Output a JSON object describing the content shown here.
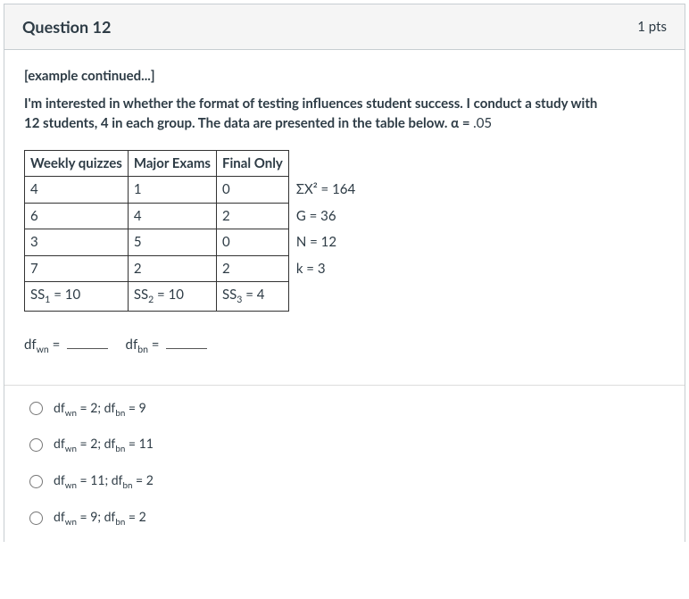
{
  "header": {
    "title": "Question 12",
    "points": "1 pts"
  },
  "intro": "[example continued...]",
  "prompt": {
    "line1": "I'm interested in whether the format of testing influences student success.  I conduct a study with",
    "line2_pre": "12 students, 4 in each group.  The data are presented in the table below.  ",
    "alpha_label": "α = ",
    "alpha_val": ".05"
  },
  "table": {
    "cols": [
      "Weekly quizzes",
      "Major Exams",
      "Final Only"
    ],
    "rows": [
      {
        "c": [
          "4",
          "1",
          "0"
        ],
        "side": "ΣX² = 164"
      },
      {
        "c": [
          "6",
          "4",
          "2"
        ],
        "side": "G = 36"
      },
      {
        "c": [
          "3",
          "5",
          "0"
        ],
        "side": "N = 12"
      },
      {
        "c": [
          "7",
          "2",
          "2"
        ],
        "side": "k = 3"
      }
    ],
    "ss": {
      "a_label": "SS",
      "a_sub": "1",
      "a_val": " = 10",
      "b_label": "SS",
      "b_sub": "2",
      "b_val": " = 10",
      "c_label": "SS",
      "c_sub": "3",
      "c_val": " = 4"
    }
  },
  "fill": {
    "a_base": "df",
    "a_sub": "wn",
    "a_eq": " = ",
    "b_base": "df",
    "b_sub": "bn",
    "b_eq": " = "
  },
  "options": [
    {
      "base1": "df",
      "sub1": "wn",
      "mid": " = 2; ",
      "base2": "df",
      "sub2": "bn",
      "tail": " = 9"
    },
    {
      "base1": "df",
      "sub1": "wn",
      "mid": " = 2; ",
      "base2": "df",
      "sub2": "bn",
      "tail": " = 11"
    },
    {
      "base1": "df",
      "sub1": "wn",
      "mid": " = 11; ",
      "base2": "df",
      "sub2": "bn",
      "tail": " = 2"
    },
    {
      "base1": "df",
      "sub1": "wn",
      "mid": " = 9; ",
      "base2": "df",
      "sub2": "bn",
      "tail": " = 2"
    }
  ]
}
